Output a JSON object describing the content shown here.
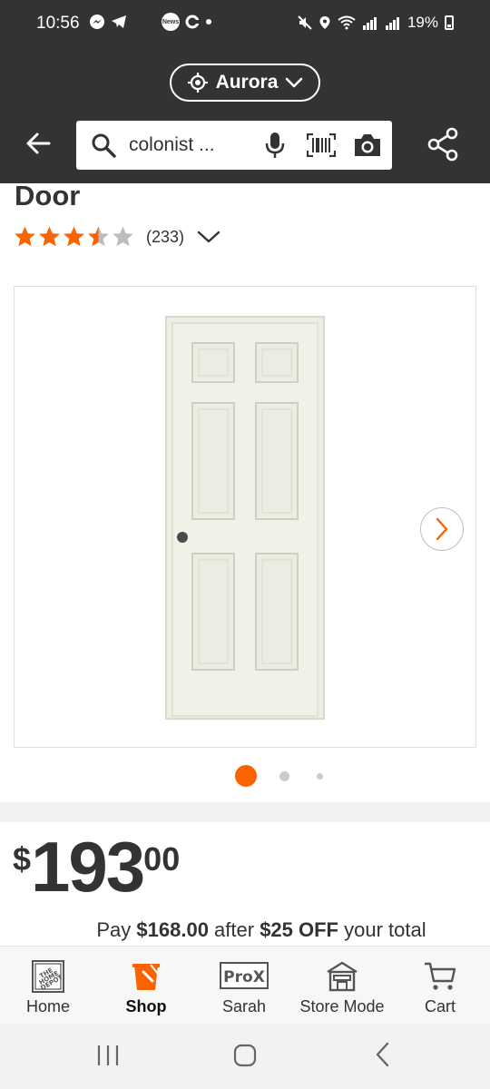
{
  "status_bar": {
    "time": "10:56",
    "battery": "19%"
  },
  "header": {
    "store_name": "Aurora",
    "search_query": "colonist ..."
  },
  "product": {
    "title_fragment": "Door",
    "rating_value": 3.5,
    "rating_count": "(233)",
    "image_count": 3,
    "active_image": 1
  },
  "price": {
    "currency": "$",
    "dollars": "193",
    "cents": "00",
    "promo": {
      "pre": "Pay ",
      "amount": "$168.00",
      "mid": " after ",
      "discount": "$25 OFF",
      "post": " your total"
    }
  },
  "bottom_nav": {
    "items": [
      {
        "label": "Home",
        "icon": "home-depot-logo-icon"
      },
      {
        "label": "Shop",
        "icon": "shop-bucket-icon"
      },
      {
        "label": "Sarah",
        "icon": "prox-icon"
      },
      {
        "label": "Store Mode",
        "icon": "store-icon"
      },
      {
        "label": "Cart",
        "icon": "cart-icon"
      }
    ],
    "active": "Shop"
  },
  "colors": {
    "header_bg": "#333333",
    "accent": "#f96302",
    "star_empty": "#bdbdbd"
  }
}
